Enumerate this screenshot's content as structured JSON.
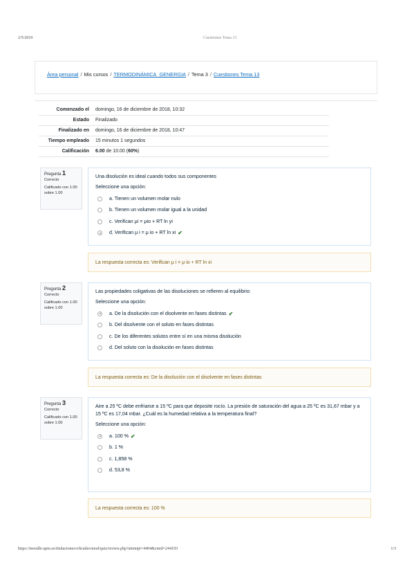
{
  "print_header": {
    "date": "2/5/2019",
    "title": "Cuestiones Tema 13"
  },
  "print_footer": {
    "url": "https://moodle.upm.es/titulaciones/oficiales/mod/quiz/review.php?attempt=4404&cmid=244193",
    "page": "1/3"
  },
  "breadcrumb": {
    "home": "Área personal",
    "sep": "/",
    "courses": "Mis cursos",
    "course": "TERMODINÁMICA_GENERGIA",
    "topic": "Tema 3",
    "quiz": "Cuestiones Tema 13"
  },
  "summary": [
    {
      "label": "Comenzado el",
      "value": "domingo, 16 de diciembre de 2018, 10:32"
    },
    {
      "label": "Estado",
      "value": "Finalizado"
    },
    {
      "label": "Finalizado en",
      "value": "domingo, 16 de diciembre de 2018, 10:47"
    },
    {
      "label": "Tiempo empleado",
      "value": "15 minutos 1 segundos"
    },
    {
      "label": "Calificación",
      "value_bold": "6.00",
      "value_mid": " de 10.00 (",
      "value_pct": "60%",
      "value_end": ")"
    }
  ],
  "questions": [
    {
      "label": "Pregunta",
      "number": "1",
      "status": "Correcto",
      "grade": "Calificado con 1.00 sobre 1.00",
      "text": "Una disolución es ideal cuando todos sus componentes",
      "select_prompt": "Seleccione una opción:",
      "options": [
        "a. Tienen un volumen molar nulo",
        "b. Tienen un volumen molar igual a la unidad",
        "c. Verifican μi = μio + RT ln yi",
        "d. Verifican μ i = μ io + RT ln xi"
      ],
      "selected_index": 3,
      "feedback": "La respuesta correcta es: Verifican μ i = μ io + RT ln xi"
    },
    {
      "label": "Pregunta",
      "number": "2",
      "status": "Correcto",
      "grade": "Calificado con 1.00 sobre 1.00",
      "text": "Las propiedades coligativas de las disoluciones se refieren al equilibrio:",
      "select_prompt": "Seleccione una opción:",
      "options": [
        "a. De la disolución con el disolvente en fases distintas",
        "b. Del disolvente con el soluto en fases distintas",
        "c. De los diferentes solutos entre sí en una misma disolución",
        "d. Del soluto con la disolución en fases distintas"
      ],
      "selected_index": 0,
      "feedback": "La respuesta correcta es: De la disolución con el disolvente en fases distintas"
    },
    {
      "label": "Pregunta",
      "number": "3",
      "status": "Correcto",
      "grade": "Calificado con 1.00 sobre 1.00",
      "text": "Aire a 25 ºC debe enfriarse a 15 ºC para que deposite rocío. La presión de saturación del agua a 25 ºC es 31,67 mbar y a 15 ºC es 17,04 mbar. ¿Cuál es la humedad relativa a la temperatura final?",
      "select_prompt": "Seleccione una opción:",
      "options": [
        "a. 100 %",
        "b. 1 %",
        "c. 1,858 %",
        "d. 53,8 %"
      ],
      "selected_index": 0,
      "feedback": "La respuesta correcta es: 100 %"
    }
  ],
  "icons": {
    "correct": "check-icon",
    "correct_glyph": "✔",
    "correct_color": "#357a32"
  }
}
